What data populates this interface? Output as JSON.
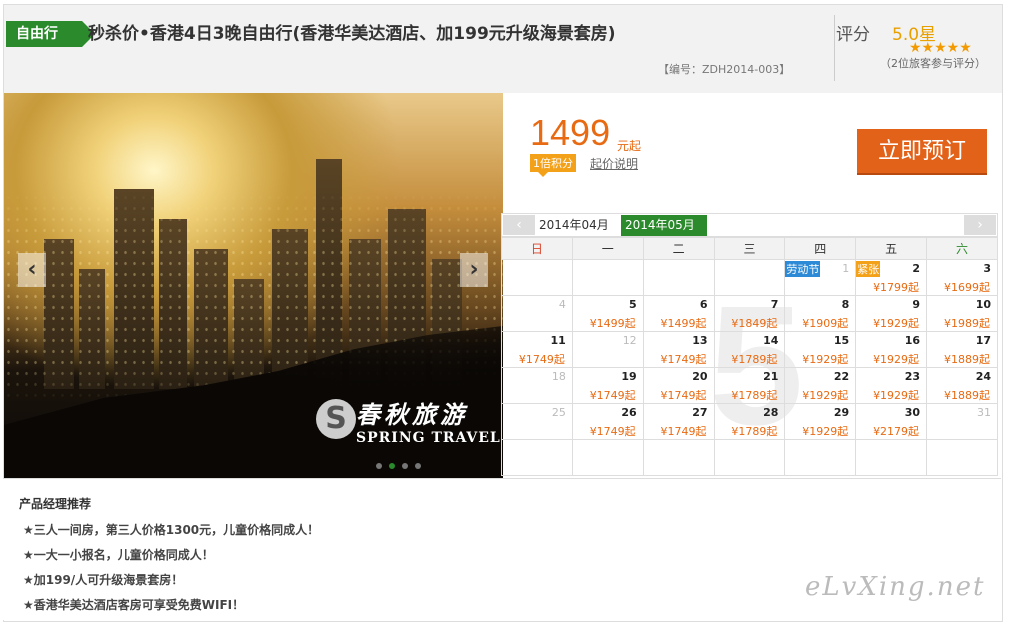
{
  "header": {
    "tag": "自由行",
    "title": "秒杀价•香港4日3晚自由行(香港华美达酒店、加199元升级海景套房)",
    "code": "【编号：ZDH2014-003】",
    "rating_label": "评分",
    "rating_value": "5.0星",
    "stars": "★★★★★",
    "rating_count": "（2位旅客参与评分）"
  },
  "photo": {
    "prev": "‹",
    "next": "›",
    "watermark_logo": "S",
    "watermark_cn": "春秋旅游",
    "watermark_en": "SPRING TRAVEL"
  },
  "price": {
    "amount": "1499",
    "unit": "元起",
    "points": "1倍积分",
    "note": "起价说明",
    "book": "立即预订"
  },
  "calendar": {
    "prev": "‹",
    "next": "›",
    "months": [
      "2014年04月",
      "2014年05月"
    ],
    "weekdays": [
      "日",
      "一",
      "二",
      "三",
      "四",
      "五",
      "六"
    ],
    "big_numeral": "5",
    "weeks": [
      [
        null,
        null,
        null,
        null,
        {
          "d": "1",
          "g": true,
          "hol": "劳动节",
          "holc": "blue"
        },
        {
          "d": "2",
          "p": "¥1799起",
          "hol": "紧张",
          "holc": "orange"
        },
        {
          "d": "3",
          "p": "¥1699起"
        }
      ],
      [
        {
          "d": "4",
          "g": true
        },
        {
          "d": "5",
          "p": "¥1499起"
        },
        {
          "d": "6",
          "p": "¥1499起"
        },
        {
          "d": "7",
          "p": "¥1849起"
        },
        {
          "d": "8",
          "p": "¥1909起"
        },
        {
          "d": "9",
          "p": "¥1929起"
        },
        {
          "d": "10",
          "p": "¥1989起"
        }
      ],
      [
        {
          "d": "11",
          "p": "¥1749起"
        },
        {
          "d": "12",
          "g": true
        },
        {
          "d": "13",
          "p": "¥1749起"
        },
        {
          "d": "14",
          "p": "¥1789起"
        },
        {
          "d": "15",
          "p": "¥1929起"
        },
        {
          "d": "16",
          "p": "¥1929起"
        },
        {
          "d": "17",
          "p": "¥1889起"
        }
      ],
      [
        {
          "d": "18",
          "g": true
        },
        {
          "d": "19",
          "p": "¥1749起"
        },
        {
          "d": "20",
          "p": "¥1749起"
        },
        {
          "d": "21",
          "p": "¥1789起"
        },
        {
          "d": "22",
          "p": "¥1929起"
        },
        {
          "d": "23",
          "p": "¥1929起"
        },
        {
          "d": "24",
          "p": "¥1889起"
        }
      ],
      [
        {
          "d": "25",
          "g": true
        },
        {
          "d": "26",
          "p": "¥1749起"
        },
        {
          "d": "27",
          "p": "¥1749起"
        },
        {
          "d": "28",
          "p": "¥1789起"
        },
        {
          "d": "29",
          "p": "¥1929起"
        },
        {
          "d": "30",
          "p": "¥2179起"
        },
        {
          "d": "31",
          "g": true
        }
      ],
      [
        null,
        null,
        null,
        null,
        null,
        null,
        null
      ]
    ]
  },
  "recommend": {
    "title": "产品经理推荐",
    "items": [
      "★三人一间房，第三人价格1300元，儿童价格同成人！",
      "★一大一小报名，儿童价格同成人！",
      "★加199/人可升级海景套房！",
      "★香港华美达酒店客房可享受免费WIFI！"
    ]
  },
  "site_watermark": "eLvXing.net",
  "colors": {
    "green": "#2b8a2b",
    "orange": "#e86a12",
    "button": "#e2621a"
  }
}
